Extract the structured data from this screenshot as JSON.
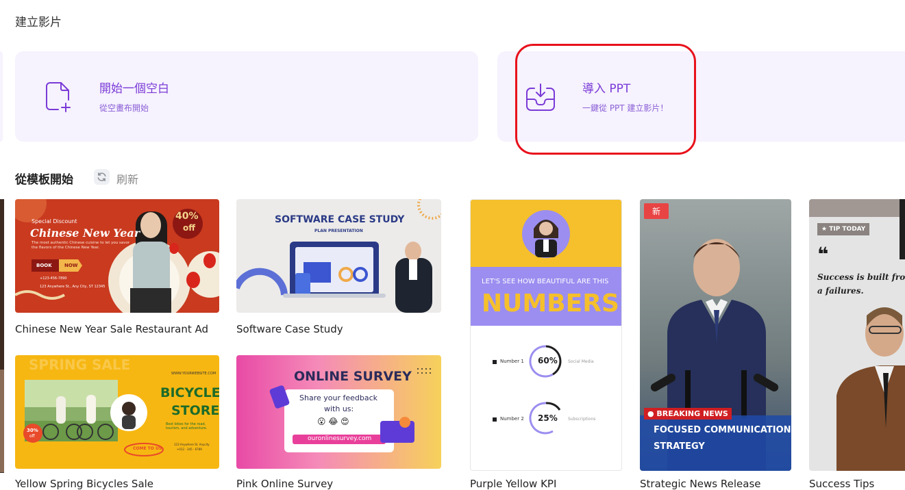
{
  "page_title": "建立影片",
  "cards": {
    "blank": {
      "title": "開始一個空白",
      "subtitle": "從空畫布開始"
    },
    "ppt": {
      "title": "導入 PPT",
      "subtitle": "一鍵從 PPT 建立影片！"
    }
  },
  "section": {
    "title": "從模板開始",
    "refresh_label": "刷新"
  },
  "templates": [
    {
      "label": "Chinese New Year Sale Restaurant Ad",
      "texts": {
        "special": "Special Discount",
        "title": "Chinese New Year",
        "desc": "The most authentic Chinese cuisine to let you savor the flavors of the Chinese New Year.",
        "book": "BOOK",
        "now": "NOW",
        "phone": "+123-456-7890",
        "address": "123 Anywhere St., Any City, ST 12345",
        "discount": "40%",
        "off": "off"
      }
    },
    {
      "label": "Software Case Study",
      "texts": {
        "title": "SOFTWARE CASE STUDY",
        "sub": "PLAN PRESENTATION"
      }
    },
    {
      "label": "Yellow Spring Bicycles Sale",
      "texts": {
        "bg": "SPRING SALE",
        "site": "WWW.YOURWEBSITE.COM",
        "title1": "BICYCLE",
        "title2": "STORE",
        "desc": "Best bikes for the road, tourism, and adventure.",
        "cta": "COME TO US",
        "pct": "30%",
        "off": "off",
        "addr": "123 Anywhere St. Anycity",
        "phone": "+012 - 345 - 6789"
      }
    },
    {
      "label": "Pink Online Survey",
      "texts": {
        "title": "ONLINE SURVEY",
        "line1": "Share your feedback",
        "line2": "with us:",
        "emoji": "😮 😂 😍",
        "url": "ouronlinesurvey.com"
      }
    },
    {
      "label": "Purple Yellow KPI",
      "texts": {
        "lead": "LET'S SEE HOW BEAUTIFUL ARE THIS",
        "title": "NUMBERS",
        "n1": "Number 1",
        "v1": "60%",
        "c1": "Social Media",
        "n2": "Number 2",
        "v2": "25%",
        "c2": "Subscriptions"
      }
    },
    {
      "label": "Strategic News Release",
      "badge": "新",
      "texts": {
        "breaking": "● BREAKING NEWS",
        "head1": "FOCUSED COMMUNICATION",
        "head2": "STRATEGY"
      }
    },
    {
      "label": "Success Tips",
      "texts": {
        "tag": "★ TIP TODAY",
        "quote_mark": "❝",
        "quote": "Success is built from a failures."
      }
    }
  ],
  "colors": {
    "accent": "#7a3ad6",
    "card_bg": "#f6f2fe",
    "highlight": "#e8111b"
  }
}
